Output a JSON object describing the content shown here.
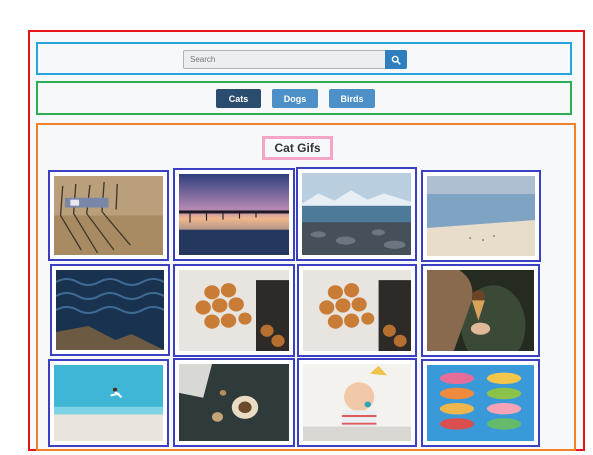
{
  "search": {
    "placeholder": "Search",
    "value": "Search"
  },
  "tabs": [
    {
      "label": "Cats",
      "active": true
    },
    {
      "label": "Dogs",
      "active": false
    },
    {
      "label": "Birds",
      "active": false
    }
  ],
  "gallery": {
    "title": "Cat Gifs",
    "images": [
      {
        "subject": "beach chairs shadows"
      },
      {
        "subject": "pier sunset"
      },
      {
        "subject": "rocky lake mountains"
      },
      {
        "subject": "sandy beach sea"
      },
      {
        "subject": "ocean waves rocks"
      },
      {
        "subject": "baked pastries"
      },
      {
        "subject": "baked pastries"
      },
      {
        "subject": "ice cream cone"
      },
      {
        "subject": "beach jump"
      },
      {
        "subject": "coffee table"
      },
      {
        "subject": "baby eating"
      },
      {
        "subject": "macarons stack"
      }
    ]
  },
  "colors": {
    "active_tab": "#2a4c6f",
    "tab": "#4d8fc7",
    "search_button": "#2f7fbf"
  }
}
